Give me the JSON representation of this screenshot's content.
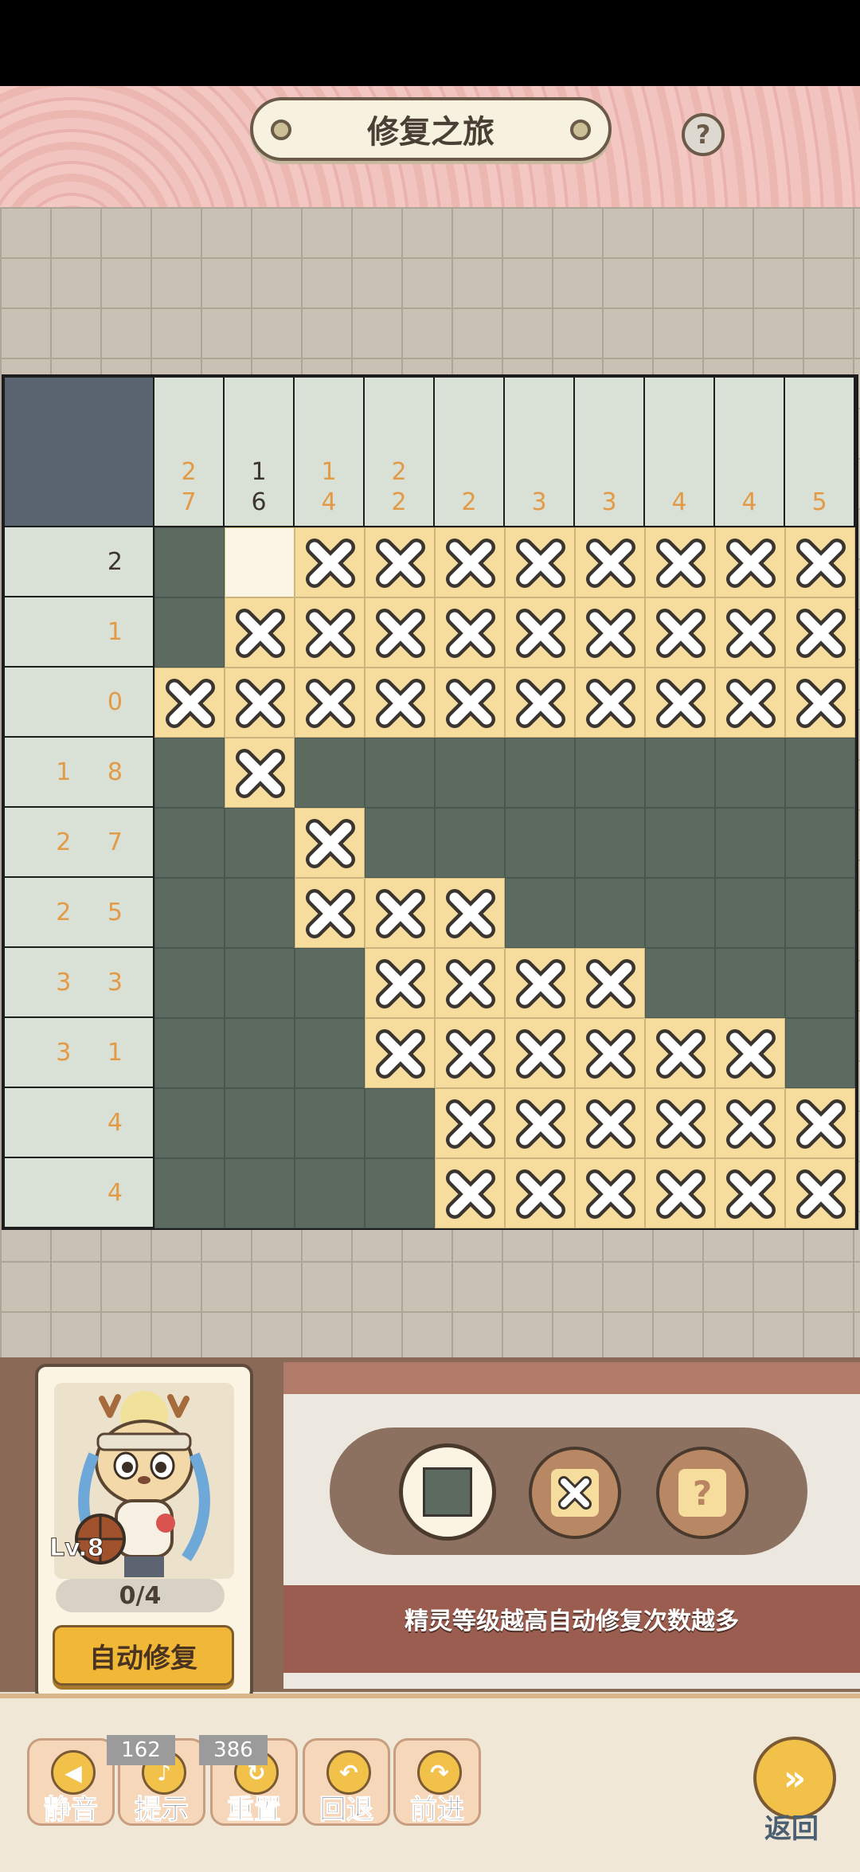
{
  "header": {
    "title": "修复之旅",
    "help_icon": "question-icon",
    "help_glyph": "?"
  },
  "puzzle": {
    "column_clues": [
      [
        "2",
        "7"
      ],
      [
        "1",
        "6"
      ],
      [
        "1",
        "4"
      ],
      [
        "2",
        "2"
      ],
      [
        "2"
      ],
      [
        "3"
      ],
      [
        "3"
      ],
      [
        "4"
      ],
      [
        "4"
      ],
      [
        "5"
      ]
    ],
    "column_done": [
      true,
      false,
      true,
      true,
      true,
      true,
      true,
      true,
      true,
      true
    ],
    "row_clues": [
      "2",
      "1",
      "0",
      "1 8",
      "2 7",
      "2 5",
      "3 3",
      "3 1",
      "4",
      "4"
    ],
    "row_done": [
      false,
      true,
      true,
      true,
      true,
      true,
      true,
      true,
      true,
      true
    ],
    "grid": [
      "FEXXXXXXXX",
      "FXXXXXXXXX",
      "XXXXXXXXXX",
      "FXFFFFFFFF",
      "FFXFFFFFFF",
      "FFXXXFFFFF",
      "FFFXXXXFFF",
      "FFFXXXXXXF",
      "FFFFXXXXXX",
      "FFFFXXXXXX"
    ],
    "cell_legend": {
      "F": "filled",
      "E": "empty",
      "X": "crossed"
    }
  },
  "character": {
    "level": "Lv.8",
    "repairs": "0/4",
    "auto_repair_label": "自动修复"
  },
  "tools": {
    "fill_icon": "square-fill-icon",
    "cross_icon": "cross-icon",
    "hint_icon": "question-icon",
    "hint_glyph": "?",
    "tip": "精灵等级越高自动修复次数越多"
  },
  "footer": {
    "mute": {
      "label": "静音",
      "icon": "speaker-icon"
    },
    "hint": {
      "label": "提示",
      "icon": "bell-icon",
      "count": "162"
    },
    "reset": {
      "label": "重置",
      "icon": "reset-icon",
      "count": "386"
    },
    "undo": {
      "label": "回退",
      "icon": "undo-icon"
    },
    "redo": {
      "label": "前进",
      "icon": "redo-icon"
    },
    "back": {
      "label": "返回",
      "icon": "arrow-right-icon"
    }
  },
  "colors": {
    "filled": "#5c6a5f",
    "crossed": "#f6dc9d",
    "empty": "#fbf5e6",
    "clue_done": "#e39a47",
    "clue_open": "#3b3530"
  }
}
